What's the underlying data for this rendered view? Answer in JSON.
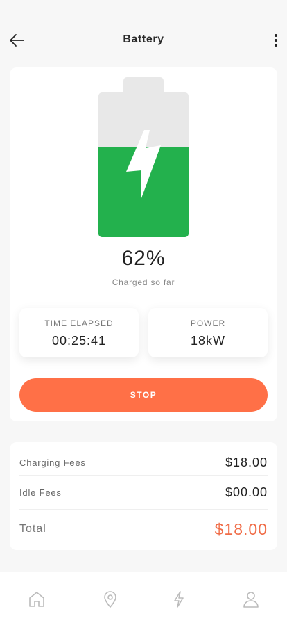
{
  "header": {
    "title": "Battery"
  },
  "battery": {
    "level": 0.62,
    "percent_label": "62%",
    "caption": "Charged so far",
    "fill_color": "#23b14d",
    "empty_color": "#e8e8e8"
  },
  "stats": {
    "time_elapsed": {
      "label": "TIME ELAPSED",
      "value": "00:25:41"
    },
    "power": {
      "label": "POWER",
      "value": "18kW"
    }
  },
  "actions": {
    "stop_label": "STOP",
    "stop_color": "#ff7047"
  },
  "fees": {
    "charging": {
      "label": "Charging Fees",
      "value": "$18.00"
    },
    "idle": {
      "label": "Idle Fees",
      "value": "$00.00"
    },
    "total": {
      "label": "Total",
      "value": "$18.00"
    },
    "total_color": "#f06c47"
  },
  "nav": {
    "items": [
      {
        "icon": "home-icon"
      },
      {
        "icon": "map-pin-icon"
      },
      {
        "icon": "lightning-icon"
      },
      {
        "icon": "user-icon"
      }
    ]
  }
}
